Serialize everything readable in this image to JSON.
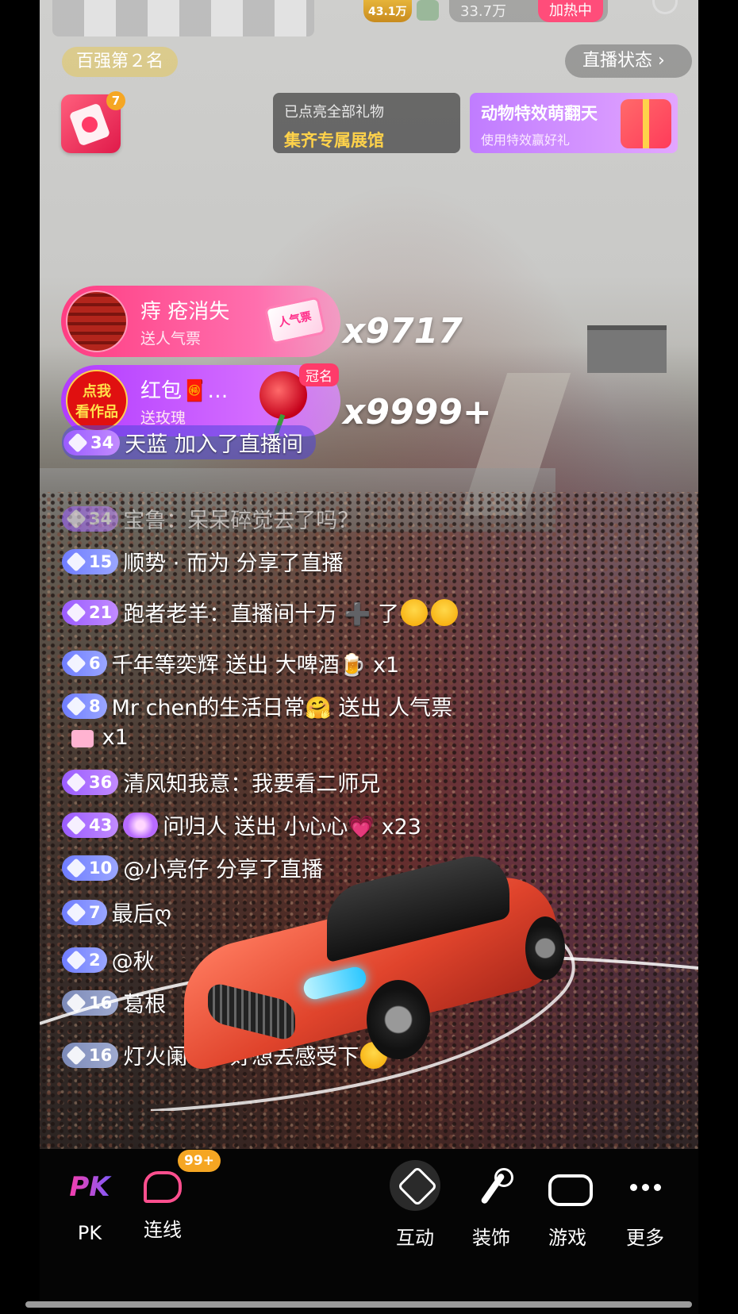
{
  "top": {
    "stat_small": "43.1万",
    "stat_pill": "33.7万",
    "heat_label": "加热中",
    "rank": "百强第２名",
    "status": "直播状态 ›"
  },
  "redbag": {
    "badge": "7"
  },
  "gift_card": {
    "line1": "已点亮全部礼物",
    "line2": "集齐专属展馆"
  },
  "anim_card": {
    "line1": "动物特效萌翻天",
    "line2": "使用特效赢好礼"
  },
  "gift_banners": [
    {
      "name": "痔 疮消失",
      "sub": "送人气票",
      "ticket": "人气票",
      "combo": "x9717"
    },
    {
      "avatar_line1": "点我",
      "avatar_line2": "看作品",
      "name": "红包🧧…",
      "sub": "送玫瑰",
      "crown": "冠名",
      "combo": "x9999+"
    }
  ],
  "chat": [
    {
      "level": "34",
      "text": "天蓝 加入了直播间"
    },
    {
      "level": "34",
      "text": "宝鲁：呆呆碎觉去了吗？"
    },
    {
      "level": "15",
      "text": "顺势 · 而为 分享了直播"
    },
    {
      "level": "21",
      "text": "跑者老羊：直播间十万 ➕ 了"
    },
    {
      "level": "6",
      "text": "千年等奕辉 送出 大啤酒🍺 x1"
    },
    {
      "level": "8",
      "text": "Mr chen的生活日常🤗 送出 人气票"
    },
    {
      "level": "",
      "text": "x1"
    },
    {
      "level": "36",
      "text": "清风知我意：我要看二师兄"
    },
    {
      "level": "43",
      "text": "问归人 送出 小心心💗 x23"
    },
    {
      "level": "10",
      "text": "@小亮仔 分享了直播"
    },
    {
      "level": "7",
      "text": "最后ღ"
    },
    {
      "level": "2",
      "text": "@秋"
    },
    {
      "level": "16",
      "text": "葛根"
    },
    {
      "level": "16",
      "text": "灯火阑珊：好想去感受下"
    }
  ],
  "toolbar": {
    "pk": "PK",
    "pk_icon": "PK",
    "link": "连线",
    "link_badge": "99+",
    "interact": "互动",
    "decorate": "装饰",
    "game": "游戏",
    "more": "更多"
  },
  "colors": {
    "accent_pink": "#ff3d82",
    "accent_purple": "#b13cff",
    "badge_orange": "#f5a623",
    "heat_pink": "#ff4d7a"
  }
}
